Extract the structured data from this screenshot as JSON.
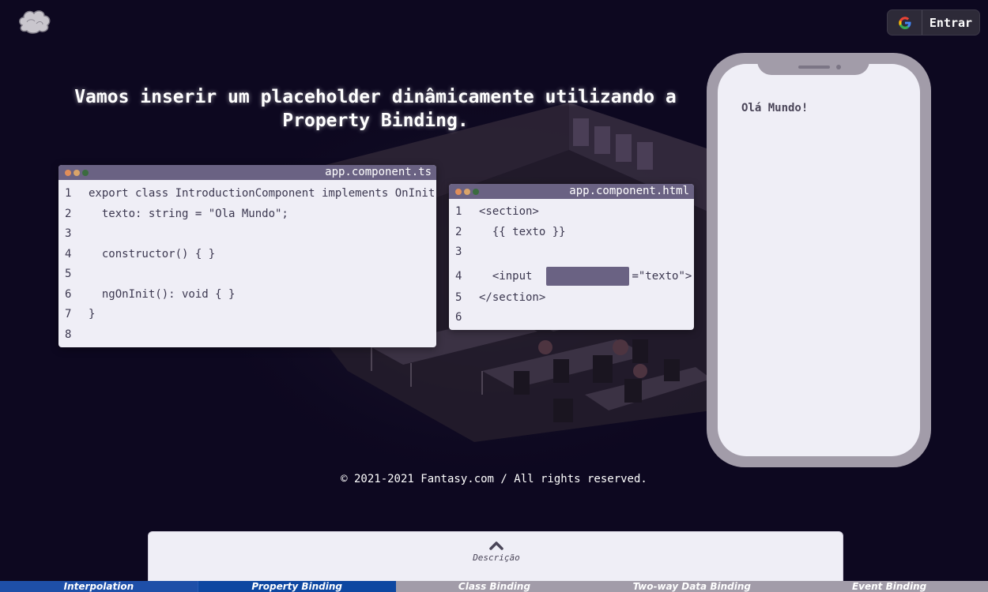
{
  "header": {
    "logo_icon": "cloud-logo-icon",
    "login": {
      "icon": "google-icon",
      "label": "Entrar"
    }
  },
  "main": {
    "heading": "Vamos inserir um placeholder dinâmicamente utilizando a Property Binding."
  },
  "editor_ts": {
    "filename": "app.component.ts",
    "lines": [
      {
        "n": "1",
        "code": "export class IntroductionComponent implements OnInit {"
      },
      {
        "n": "2",
        "code": "  texto: string = \"Ola Mundo\";"
      },
      {
        "n": "3",
        "code": ""
      },
      {
        "n": "4",
        "code": "  constructor() { }"
      },
      {
        "n": "5",
        "code": ""
      },
      {
        "n": "6",
        "code": "  ngOnInit(): void { }"
      },
      {
        "n": "7",
        "code": "}"
      },
      {
        "n": "8",
        "code": ""
      }
    ]
  },
  "editor_html": {
    "filename": "app.component.html",
    "lines": [
      {
        "n": "1",
        "code": "<section>"
      },
      {
        "n": "2",
        "code": "  {{ texto }}"
      },
      {
        "n": "3",
        "code": ""
      },
      {
        "n": "4",
        "code_before": "  <input",
        "code_after": "=\"texto\">"
      },
      {
        "n": "5",
        "code": "</section>"
      },
      {
        "n": "6",
        "code": ""
      }
    ]
  },
  "phone": {
    "output_text": "Olá Mundo!"
  },
  "footer": {
    "copyright": "© 2021-2021 Fantasy.com / All rights reserved."
  },
  "description": {
    "icon": "chevron-up-icon",
    "label": "Descrição"
  },
  "tabs": [
    {
      "label": "Interpolation",
      "state": "done"
    },
    {
      "label": "Property Binding",
      "state": "active"
    },
    {
      "label": "Class Binding",
      "state": "todo"
    },
    {
      "label": "Two-way Data Binding",
      "state": "todo"
    },
    {
      "label": "Event Binding",
      "state": "todo"
    }
  ],
  "colors": {
    "background": "#0d0820",
    "panel": "#efeef6",
    "titlebar": "#6a6283",
    "phone_frame": "#a29ca9",
    "tab_active": "#0d47a1",
    "tab_done": "#1e4fa8",
    "tab_todo": "#a29ca9"
  }
}
